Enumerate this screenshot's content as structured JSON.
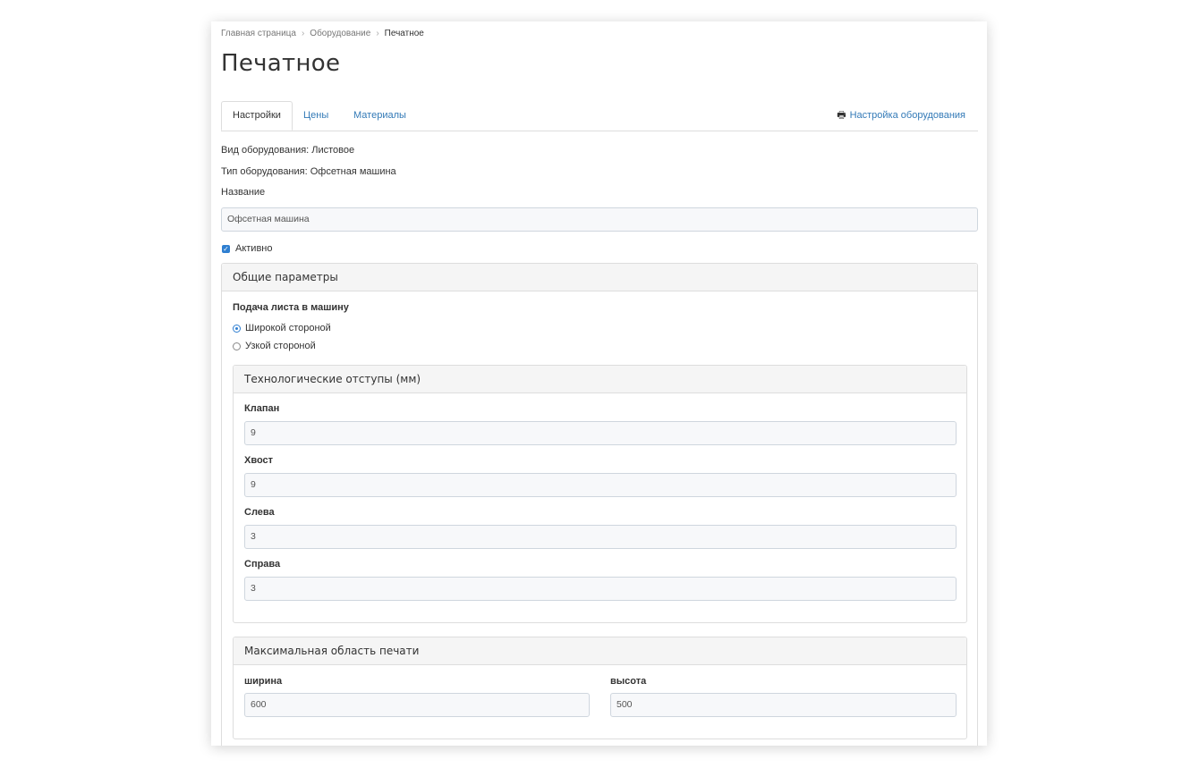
{
  "breadcrumb": [
    "Главная страница",
    "Оборудование",
    "Печатное"
  ],
  "page_title": "Печатное",
  "tabs": [
    {
      "label": "Настройки",
      "active": true
    },
    {
      "label": "Цены",
      "active": false
    },
    {
      "label": "Материалы",
      "active": false
    }
  ],
  "equipment_settings_link": {
    "icon": "printer-icon",
    "label": "Настройка оборудования"
  },
  "info": {
    "equipment_kind": "Вид оборудования: Листовое",
    "equipment_type": "Тип оборудования: Офсетная машина"
  },
  "name_field": {
    "label": "Название",
    "value": "Офсетная машина"
  },
  "active_checkbox": {
    "label": "Активно",
    "checked": true
  },
  "general_panel": {
    "title": "Общие параметры",
    "feed_label": "Подача листа в машину",
    "feed_options": [
      {
        "label": "Широкой стороной",
        "selected": true
      },
      {
        "label": "Узкой стороной",
        "selected": false
      }
    ]
  },
  "margins_panel": {
    "title": "Технологические отступы (мм)",
    "fields": [
      {
        "label": "Клапан",
        "value": "9"
      },
      {
        "label": "Хвост",
        "value": "9"
      },
      {
        "label": "Слева",
        "value": "3"
      },
      {
        "label": "Справа",
        "value": "3"
      }
    ]
  },
  "print_area_panel": {
    "title": "Максимальная область печати",
    "width_label": "ширина",
    "width_value": "600",
    "height_label": "высота",
    "height_value": "500"
  },
  "colors": {
    "accent": "#337ab7",
    "checkbox": "#2f7fd1",
    "panel_header": "#f5f5f5",
    "border": "#dddddd"
  }
}
